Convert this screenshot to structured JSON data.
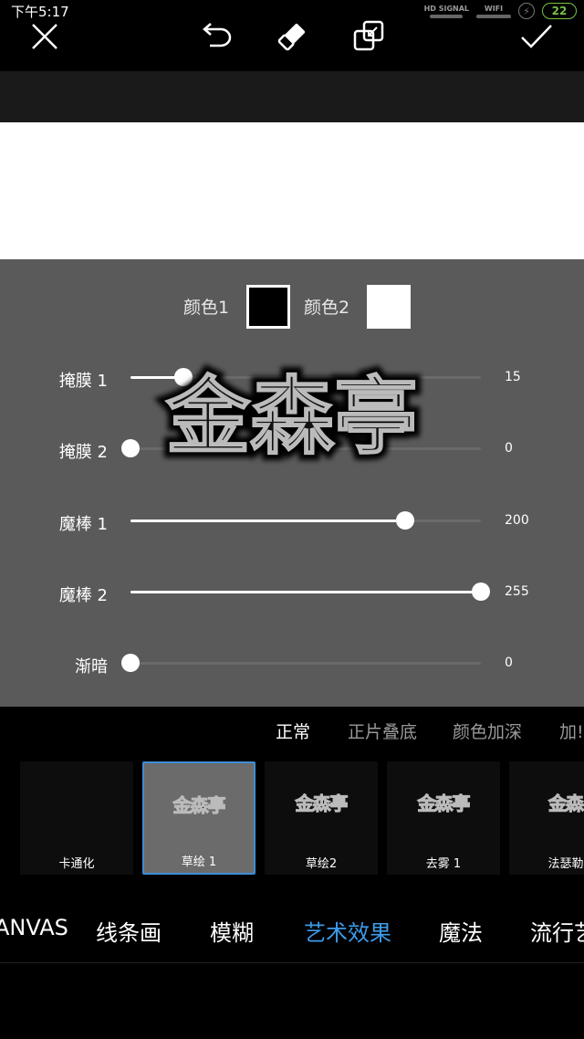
{
  "status": {
    "time": "下午5:17",
    "signal_label": "HD SIGNAL",
    "wifi_label": "WIFI",
    "battery": "22"
  },
  "toolbar": {
    "close_icon": "close-icon",
    "undo_icon": "undo-icon",
    "eraser_icon": "eraser-icon",
    "compare_icon": "compare-icon",
    "confirm_icon": "check-icon"
  },
  "colors": {
    "color1_label": "颜色1",
    "color1_value": "#000000",
    "color2_label": "颜色2",
    "color2_value": "#ffffff"
  },
  "watermark": "金森亭",
  "sliders": [
    {
      "label": "掩膜 1",
      "value": "15",
      "fraction": 0.15
    },
    {
      "label": "掩膜 2",
      "value": "0",
      "fraction": 0.0
    },
    {
      "label": "魔棒 1",
      "value": "200",
      "fraction": 0.784
    },
    {
      "label": "魔棒 2",
      "value": "255",
      "fraction": 1.0
    },
    {
      "label": "渐暗",
      "value": "0",
      "fraction": 0.0
    }
  ],
  "blend_modes": [
    "正常",
    "正片叠底",
    "颜色加深",
    "加!"
  ],
  "blend_active": "正常",
  "effects": [
    {
      "label": "卡通化",
      "art": "",
      "selected": false
    },
    {
      "label": "草绘 1",
      "art": "金森亭",
      "selected": true
    },
    {
      "label": "草绘2",
      "art": "金森亭",
      "selected": false
    },
    {
      "label": "去雾 1",
      "art": "金森亭",
      "selected": false
    },
    {
      "label": "法瑟勒",
      "art": "金森",
      "selected": false
    }
  ],
  "categories": [
    "ANVAS",
    "线条画",
    "模糊",
    "艺术效果",
    "魔法",
    "流行艺"
  ],
  "category_active": "艺术效果",
  "accent_color": "#3d9be9"
}
